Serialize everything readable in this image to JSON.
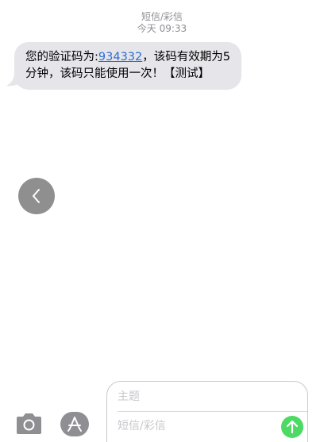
{
  "header": {
    "title": "短信/彩信",
    "timestamp": "今天 09:33"
  },
  "message": {
    "text_before": "您的验证码为:",
    "code": "934332",
    "text_after": "，该码有效期为5分钟，该码只能使用一次！【测试】"
  },
  "icons": {
    "back": "chevron-left-icon",
    "camera": "camera-icon",
    "app_store": "app-store-icon",
    "send": "arrow-up-icon"
  },
  "compose": {
    "subject_placeholder": "主题",
    "message_placeholder": "短信/彩信"
  },
  "colors": {
    "bubble": "#e5e5ea",
    "link": "#2a6ed5",
    "send": "#4cd964",
    "secondary_text": "#8e8e93"
  }
}
